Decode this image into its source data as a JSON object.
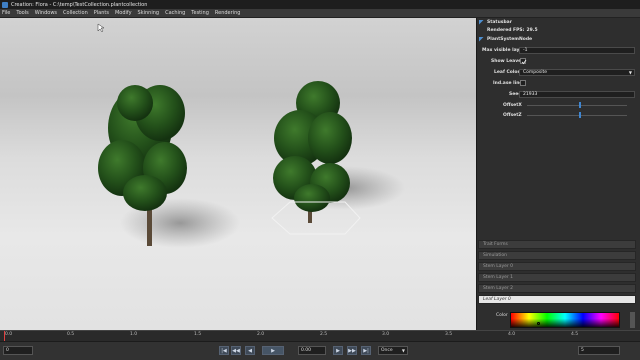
{
  "window": {
    "title": "Creation: Flora - C:\\temp\\TestCollection.plantcollection"
  },
  "menu": [
    "File",
    "Tools",
    "Windows",
    "Collection",
    "Plants",
    "Modify",
    "Skinning",
    "Caching",
    "Testing",
    "Rendering"
  ],
  "panel": {
    "statusbar_label": "Statusbar",
    "fps_label": "Rendered FPS:",
    "fps_value": "29.5",
    "node_label": "PlantSystemNode",
    "max_layers_label": "Max visible layers",
    "max_layers_value": "-1",
    "show_leaves_label": "Show Leaves",
    "show_leaves_checked": true,
    "leaf_colors_label": "Leaf Colors",
    "leaf_colors_value": "Composite",
    "indicators_label": "Ind.ase lines",
    "seed_label": "Seed",
    "seed_value": "21933",
    "offsetx_label": "OffsetX",
    "offsetz_label": "OffsetZ",
    "offsetx_level": 0.52,
    "offsetz_level": 0.52
  },
  "sections": [
    "Trait Forms",
    "Simulation",
    "Stem Layer 0",
    "Stem Layer 1",
    "Stem Layer 2",
    "Leaf Layer 0"
  ],
  "color_section": {
    "label": "Color"
  },
  "timeline": {
    "ticks": [
      "0.0",
      "0.5",
      "1.0",
      "1.5",
      "2.0",
      "2.5",
      "3.0",
      "3.5",
      "4.0",
      "4.5"
    ]
  },
  "controls": {
    "start_value": "0",
    "time_value": "0.00",
    "loop_mode": "Once",
    "end_value": "5",
    "skip_start": "|◀",
    "prev_frame": "◀◀",
    "play": "▶",
    "next_frame": "▶▶",
    "skip_end": "▶|"
  }
}
